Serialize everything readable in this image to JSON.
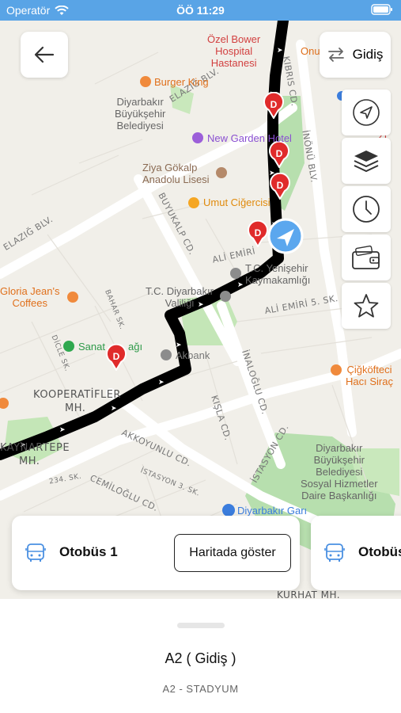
{
  "status_bar": {
    "carrier": "Operatör",
    "time": "ÖÖ 11:29"
  },
  "top_controls": {
    "direction_label": "Gidiş"
  },
  "map": {
    "street_labels": [
      "ELAZIĞ BLV.",
      "ELAZIĞ BLV.",
      "KIBRIS CD.",
      "İNÖNÜ BLV.",
      "BUYUKALP CD.",
      "ALİ EMİRİ",
      "ALİ EMİRİ 5. SK.",
      "BAHAR SK.",
      "DİCLE SK.",
      "İNALOĞLU CD.",
      "KIŞLA CD.",
      "AKKOYUNLU CD.",
      "İSTASYON CD.",
      "CEMİLOĞLU CD.",
      "İSTASYON 3. SK.",
      "234. SK.",
      "KURHAT MH.",
      "KOOPERATİFLER",
      "MH.",
      "KAYNARTEPE",
      "MH."
    ],
    "pois": {
      "hospital": "Özel Bower\nHospital\nHastanesi",
      "onur": "Onu",
      "burger_king": "Burger King",
      "municipality": "Diyarbakır\nBüyükşehir\nBelediyesi",
      "new_garden": "New Garden Hotel",
      "ziya": "Ziya Gökalp\nAnadolu Lisesi",
      "umut": "Umut Ciğercisi",
      "kaymakamlik": "T.C. Yenişehir\nKaymakamlığı",
      "valilik": "T.C. Diyarbakır\nValiliği",
      "gloria": "Gloria Jean's\nCoffees",
      "sanat": "Sanat",
      "sanat_tail": "ağı",
      "akbank": "Akbank",
      "cigkofte": "Çiğköfteci\nHacı Siraç",
      "social_services": "Diyarbakır\nBüyükşehir\nBelediyesi\nSosyal Hizmetler\nDaire Başkanlığı",
      "gar": "Diyarbakır Garı",
      "zi": "Zi"
    },
    "stop_marker_letter": "D"
  },
  "vehicle_cards": [
    {
      "title": "Otobüs 1",
      "button": "Haritada göster"
    },
    {
      "title": "Otobüs"
    }
  ],
  "bottom_sheet": {
    "route_title": "A2 ( Gidiş )",
    "route_subtitle": "A2 - STADYUM"
  }
}
